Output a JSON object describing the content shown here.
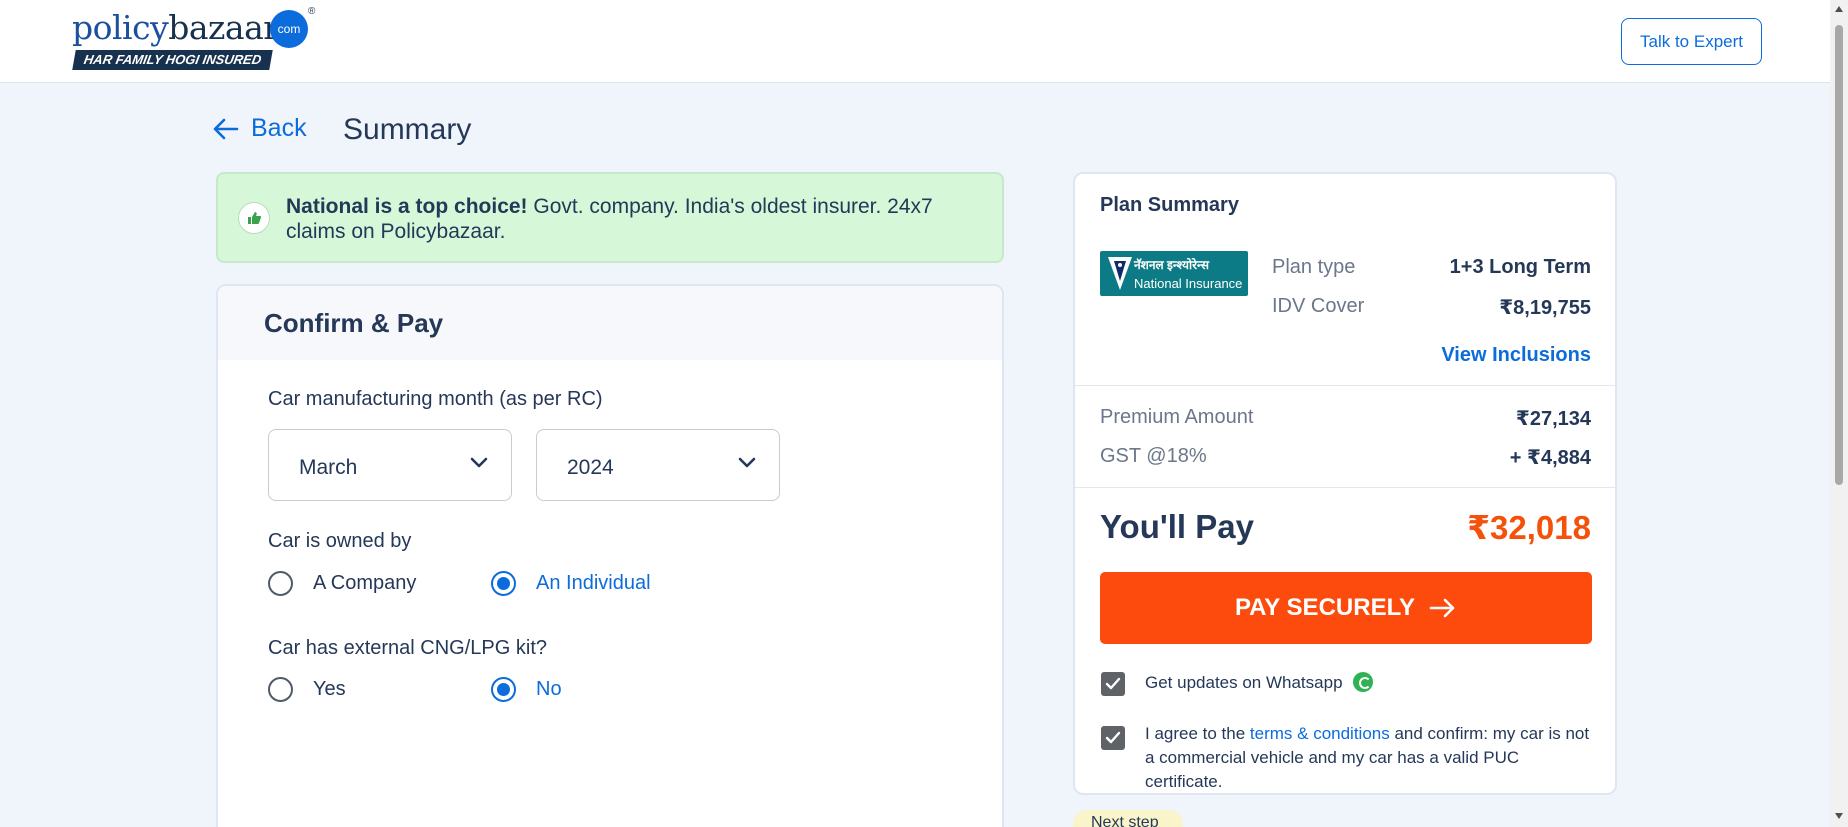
{
  "header": {
    "logo_word_a": "policy",
    "logo_word_b": "bazaar",
    "logo_dot": "com",
    "logo_reg": "®",
    "tagline": "HAR FAMILY HOGI INSURED",
    "expert_btn": "Talk to Expert"
  },
  "nav": {
    "back": "Back",
    "title": "Summary"
  },
  "banner": {
    "bold": "National is a top choice!",
    "text": " Govt. company. India's oldest insurer. 24x7 claims on Policybazaar."
  },
  "confirm": {
    "title": "Confirm & Pay",
    "mfg_label": "Car manufacturing month (as per RC)",
    "month_value": "March",
    "year_value": "2024",
    "owner_label": "Car is owned by",
    "owner_options": [
      "A Company",
      "An Individual"
    ],
    "owner_selected": "An Individual",
    "cng_label": "Car has external CNG/LPG kit?",
    "cng_options": [
      "Yes",
      "No"
    ],
    "cng_selected": "No"
  },
  "plan": {
    "title": "Plan Summary",
    "insurer_hindi": "नॅशनल इन्श्योरेन्स",
    "insurer_name": "National Insurance",
    "plan_type_label": "Plan type",
    "plan_type_value": "1+3 Long Term",
    "idv_label": "IDV Cover",
    "idv_value": "₹8,19,755",
    "view_inclusions": "View Inclusions",
    "premium_label": "Premium Amount",
    "premium_value": "₹27,134",
    "gst_label": "GST @18%",
    "gst_value": "+ ₹4,884",
    "pay_label": "You'll Pay",
    "pay_value": "₹32,018",
    "pay_button": "PAY SECURELY",
    "whatsapp_text": "Get updates on Whatsapp",
    "whatsapp_checked": true,
    "terms_prefix": "I agree to the ",
    "terms_link": "terms & conditions",
    "terms_suffix": " and confirm: my car is not a commercial vehicle and my car has a valid PUC certificate.",
    "terms_checked": true
  },
  "next_step": "Next step",
  "colors": {
    "brand_blue": "#0c6cdc",
    "pay_orange": "#fc4b0c",
    "banner_green": "#d6f8d8"
  }
}
